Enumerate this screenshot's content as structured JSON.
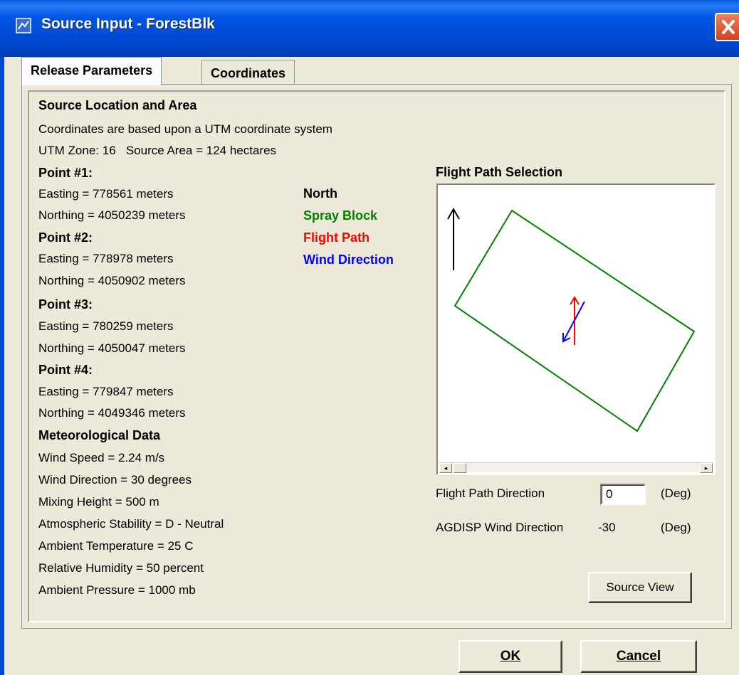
{
  "window": {
    "title": "Source Input - ForestBlk"
  },
  "tabs": [
    {
      "label": "Release Parameters",
      "active": true
    },
    {
      "label": "Coordinates",
      "active": false
    }
  ],
  "source": {
    "heading": "Source Location and Area",
    "coord_note": "Coordinates are based upon a UTM coordinate system",
    "zone_area": "UTM Zone: 16   Source Area = 124 hectares",
    "points": [
      {
        "title": "Point #1:",
        "easting": "Easting = 778561 meters",
        "northing": "Northing = 4050239 meters"
      },
      {
        "title": "Point #2:",
        "easting": "Easting = 778978 meters",
        "northing": "Northing = 4050902 meters"
      },
      {
        "title": "Point #3:",
        "easting": "Easting = 780259 meters",
        "northing": "Northing = 4050047 meters"
      },
      {
        "title": "Point #4:",
        "easting": "Easting = 779847 meters",
        "northing": "Northing = 4049346 meters"
      }
    ]
  },
  "legend": [
    {
      "label": "North",
      "color": "#000000"
    },
    {
      "label": "Spray Block",
      "color": "#008000"
    },
    {
      "label": "Flight Path",
      "color": "#FF0000"
    },
    {
      "label": "Wind Direction",
      "color": "#0000FF"
    }
  ],
  "met": {
    "heading": "Meteorological  Data",
    "lines": [
      "Wind Speed = 2.24 m/s",
      "Wind Direction = 30 degrees",
      "Mixing Height = 500 m",
      "Atmospheric Stability = D - Neutral",
      "Ambient Temperature = 25 C",
      "Relative Humidity = 50 percent",
      "Ambient Pressure = 1000 mb"
    ]
  },
  "flight_path": {
    "heading": "Flight Path Selection",
    "direction_label": "Flight Path Direction",
    "direction_value": "0",
    "direction_unit": "(Deg)",
    "agdisp_label": "AGDISP Wind Direction",
    "agdisp_value": "-30",
    "agdisp_unit": "(Deg)",
    "source_view_label": "Source View"
  },
  "buttons": {
    "ok": "OK",
    "cancel": "Cancel"
  },
  "colors": {
    "title_bar": "#0055E5",
    "dialog_bg": "#ECE9D8",
    "close_button": "#D2431E"
  }
}
